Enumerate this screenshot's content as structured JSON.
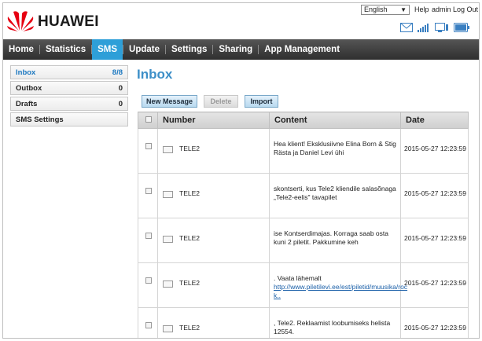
{
  "header": {
    "brand": "HUAWEI",
    "language": "English",
    "help": "Help",
    "user": "admin",
    "logout": "Log Out",
    "icons": [
      "mail-icon",
      "signal-icon",
      "connection-icon",
      "battery-icon"
    ]
  },
  "nav": {
    "items": [
      {
        "label": "Home"
      },
      {
        "label": "Statistics"
      },
      {
        "label": "SMS"
      },
      {
        "label": "Update"
      },
      {
        "label": "Settings"
      },
      {
        "label": "Sharing"
      },
      {
        "label": "App Management"
      }
    ],
    "active": "SMS",
    "active_color": "#2e9fd8"
  },
  "sidebar": {
    "items": [
      {
        "label": "Inbox",
        "count": "8/8"
      },
      {
        "label": "Outbox",
        "count": "0"
      },
      {
        "label": "Drafts",
        "count": "0"
      },
      {
        "label": "SMS Settings",
        "count": ""
      }
    ]
  },
  "main": {
    "title": "Inbox",
    "buttons": {
      "new_message": "New Message",
      "delete": "Delete",
      "import": "Import"
    },
    "columns": {
      "number": "Number",
      "content": "Content",
      "date": "Date"
    },
    "rows": [
      {
        "number": "TELE2",
        "content": "Hea klient! Eksklusiivne Elina Born & Stig Rästa ja Daniel Levi ühi",
        "link": "",
        "date": "2015-05-27 12:23:59"
      },
      {
        "number": "TELE2",
        "content": "skontserti, kus Tele2 kliendile salasõnaga „Tele2-eelis\" tavapilet",
        "link": "",
        "date": "2015-05-27 12:23:59"
      },
      {
        "number": "TELE2",
        "content": "ise Kontserdimajas. Korraga saab osta kuni 2 piletit. Pakkumine keh",
        "link": "",
        "date": "2015-05-27 12:23:59"
      },
      {
        "number": "TELE2",
        "content": ". Vaata lähemalt",
        "link": "http://www.piletilevi.ee/est/piletid/muusika/roc k..",
        "date": "2015-05-27 12:23:59"
      },
      {
        "number": "TELE2",
        "content": ", Tele2. Reklaamist loobumiseks helista 12554.",
        "link": "",
        "date": "2015-05-27 12:23:59"
      }
    ]
  }
}
